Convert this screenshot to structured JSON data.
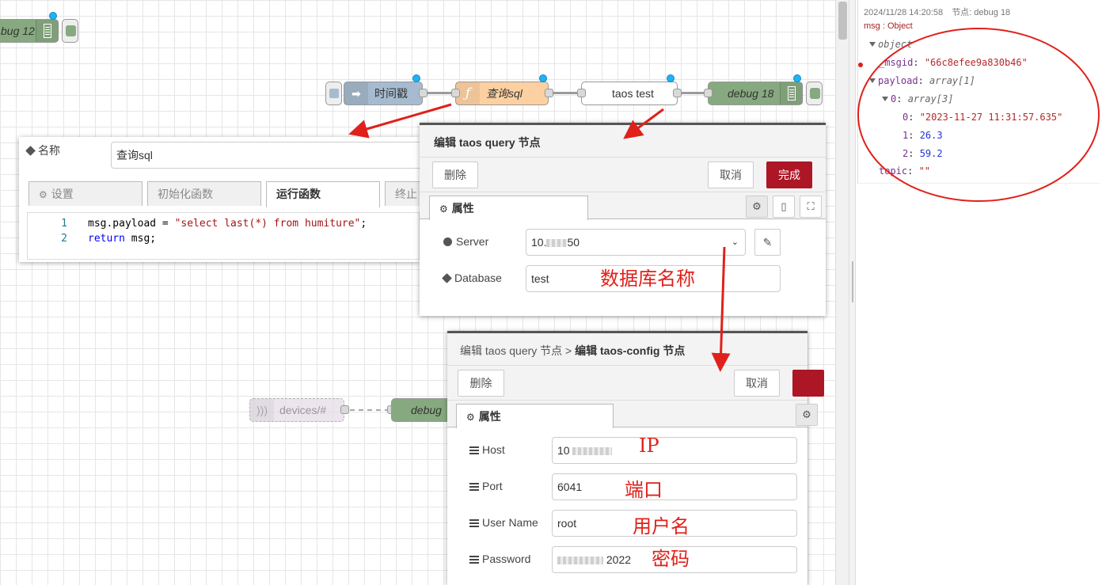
{
  "flow": {
    "nodes": {
      "debug12": "bug 12",
      "timestamp": "时间戳",
      "query_sql": "查询sql",
      "taos_test": "taos test",
      "debug18": "debug 18",
      "devices": "devices/#",
      "debug_partial": "debug"
    }
  },
  "function_editor": {
    "name_label": "名称",
    "name_value": "查询sql",
    "tabs": [
      "设置",
      "初始化函数",
      "运行函数",
      "终止"
    ],
    "code": [
      {
        "line": "1",
        "parts": [
          [
            "plain",
            "msg.payload = "
          ],
          [
            "str",
            "\"select last(*) from humiture\""
          ],
          [
            "plain",
            ";"
          ]
        ]
      },
      {
        "line": "2",
        "parts": [
          [
            "kw",
            "return"
          ],
          [
            "plain",
            " msg;"
          ]
        ]
      }
    ]
  },
  "taos_query_editor": {
    "title": "编辑 taos query 节点",
    "delete_label": "删除",
    "cancel_label": "取消",
    "done_label": "完成",
    "tab_label": "属性",
    "server_label": "Server",
    "server_value_prefix": "10.",
    "server_value_suffix": "50",
    "database_label": "Database",
    "database_value": "test",
    "database_note": "数据库名称"
  },
  "taos_config_editor": {
    "breadcrumb_parent": "编辑 taos query 节点",
    "breadcrumb_sep": ">",
    "title": "编辑 taos-config 节点",
    "delete_label": "删除",
    "cancel_label": "取消",
    "tab_label": "属性",
    "host_label": "Host",
    "host_value_prefix": "10",
    "host_note": "IP",
    "port_label": "Port",
    "port_value": "6041",
    "port_note": "端口",
    "username_label": "User Name",
    "username_value": "root",
    "username_note": "用户名",
    "password_label": "Password",
    "password_value_suffix": "2022",
    "password_note": "密码"
  },
  "debug_panel": {
    "timestamp": "2024/11/28 14:20:58",
    "node_label": "节点: debug 18",
    "msg_type": "msg : Object",
    "tree": {
      "root": "object",
      "msgid_key": "_msgid",
      "msgid_value": "\"66c8efee9a830b46\"",
      "payload_key": "payload",
      "payload_type": "array[1]",
      "item0_key": "0",
      "item0_type": "array[3]",
      "values": [
        {
          "k": "0",
          "v": "\"2023-11-27 11:31:57.635\"",
          "type": "string"
        },
        {
          "k": "1",
          "v": "26.3",
          "type": "number"
        },
        {
          "k": "2",
          "v": "59.2",
          "type": "number"
        }
      ],
      "topic_key": "topic",
      "topic_value": "\"\""
    }
  },
  "colors": {
    "function_node": "#fdd0a2",
    "inject_node": "#a6bbcf",
    "debug_node": "#87a980",
    "deploy_red": "#ad1625",
    "annotation_red": "#e0201a",
    "port_dot": "#1fb3f5"
  }
}
